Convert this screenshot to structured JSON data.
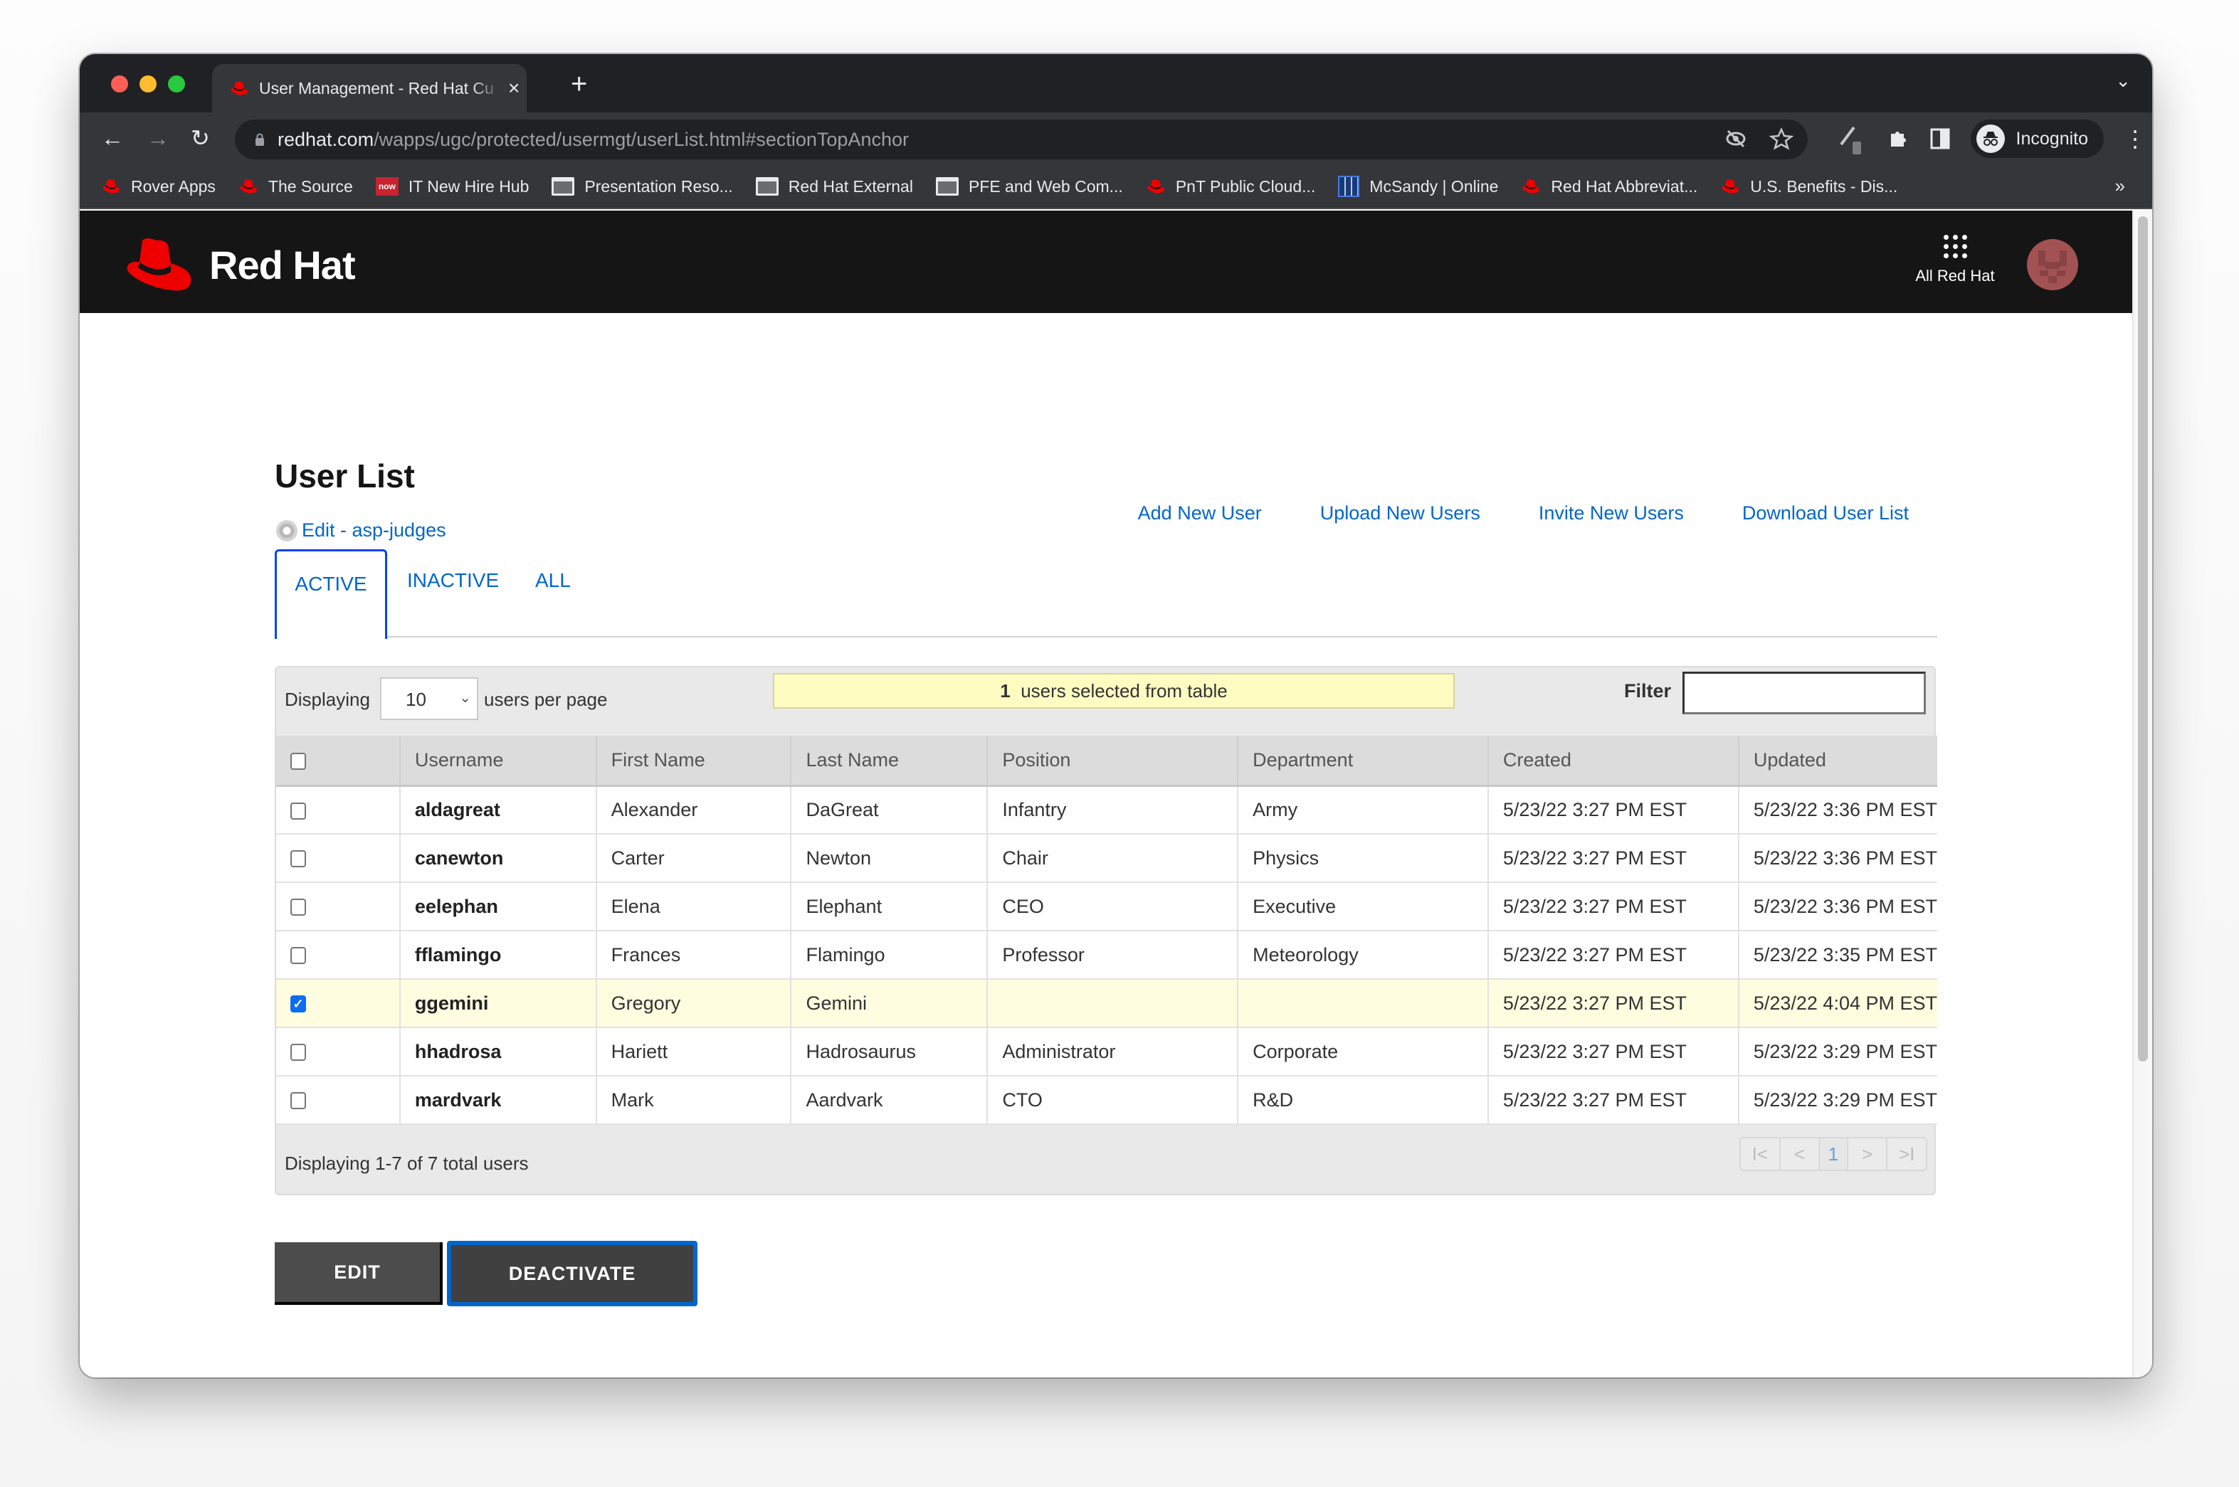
{
  "browser": {
    "tab_title": "User Management - Red Hat Cu",
    "new_tab_label": "+",
    "url_host": "redhat.com",
    "url_path": "/wapps/ugc/protected/usermgt/userList.html#sectionTopAnchor",
    "profile_label": "Incognito",
    "bookmarks": [
      {
        "label": "Rover Apps",
        "icon": "redhat-hat-icon"
      },
      {
        "label": "The Source",
        "icon": "redhat-hat-icon"
      },
      {
        "label": "IT New Hire Hub",
        "icon": "servicenow-icon"
      },
      {
        "label": "Presentation Reso...",
        "icon": "folder-icon"
      },
      {
        "label": "Red Hat External",
        "icon": "folder-icon"
      },
      {
        "label": "PFE and Web Com...",
        "icon": "folder-icon"
      },
      {
        "label": "PnT Public Cloud...",
        "icon": "redhat-hat-icon"
      },
      {
        "label": "McSandy | Online",
        "icon": "building-icon"
      },
      {
        "label": "Red Hat Abbreviat...",
        "icon": "redhat-hat-icon"
      },
      {
        "label": "U.S. Benefits - Dis...",
        "icon": "redhat-hat-icon"
      }
    ],
    "bookmarks_overflow": "»"
  },
  "header": {
    "logo_text": "Red Hat",
    "all_red_hat_label": "All Red Hat"
  },
  "page": {
    "title": "User List",
    "edit_link": "Edit - asp-judges",
    "actions": [
      "Add New User",
      "Upload New Users",
      "Invite New Users",
      "Download User List"
    ],
    "tabs": [
      {
        "label": "ACTIVE",
        "active": true
      },
      {
        "label": "INACTIVE",
        "active": false
      },
      {
        "label": "ALL",
        "active": false
      }
    ]
  },
  "table_controls": {
    "displaying_label": "Displaying",
    "per_page_value": "10",
    "per_page_suffix": "users per page",
    "selected_count": "1",
    "selected_text": "users selected from table",
    "filter_label": "Filter",
    "filter_value": ""
  },
  "table": {
    "columns": [
      "Username",
      "First Name",
      "Last Name",
      "Position",
      "Department",
      "Created",
      "Updated"
    ],
    "rows": [
      {
        "selected": false,
        "username": "aldagreat",
        "first": "Alexander",
        "last": "DaGreat",
        "position": "Infantry",
        "department": "Army",
        "created": "5/23/22 3:27 PM EST",
        "updated": "5/23/22 3:36 PM EST"
      },
      {
        "selected": false,
        "username": "canewton",
        "first": "Carter",
        "last": "Newton",
        "position": "Chair",
        "department": "Physics",
        "created": "5/23/22 3:27 PM EST",
        "updated": "5/23/22 3:36 PM EST"
      },
      {
        "selected": false,
        "username": "eelephan",
        "first": "Elena",
        "last": "Elephant",
        "position": "CEO",
        "department": "Executive",
        "created": "5/23/22 3:27 PM EST",
        "updated": "5/23/22 3:36 PM EST"
      },
      {
        "selected": false,
        "username": "fflamingo",
        "first": "Frances",
        "last": "Flamingo",
        "position": "Professor",
        "department": "Meteorology",
        "created": "5/23/22 3:27 PM EST",
        "updated": "5/23/22 3:35 PM EST"
      },
      {
        "selected": true,
        "username": "ggemini",
        "first": "Gregory",
        "last": "Gemini",
        "position": "",
        "department": "",
        "created": "5/23/22 3:27 PM EST",
        "updated": "5/23/22 4:04 PM EST"
      },
      {
        "selected": false,
        "username": "hhadrosa",
        "first": "Hariett",
        "last": "Hadrosaurus",
        "position": "Administrator",
        "department": "Corporate",
        "created": "5/23/22 3:27 PM EST",
        "updated": "5/23/22 3:29 PM EST"
      },
      {
        "selected": false,
        "username": "mardvark",
        "first": "Mark",
        "last": "Aardvark",
        "position": "CTO",
        "department": "R&D",
        "created": "5/23/22 3:27 PM EST",
        "updated": "5/23/22 3:29 PM EST"
      }
    ],
    "footer_text": "Displaying 1-7 of 7 total users",
    "pager": {
      "first": "I<",
      "prev": "<",
      "current_page": "1",
      "next": ">",
      "last": ">I"
    }
  },
  "buttons": {
    "edit": "EDIT",
    "deactivate": "DEACTIVATE"
  },
  "colors": {
    "brand_red": "#ee0000",
    "link_blue": "#0066cc",
    "selected_row": "#fefde0",
    "selection_banner": "#fffcc2"
  }
}
